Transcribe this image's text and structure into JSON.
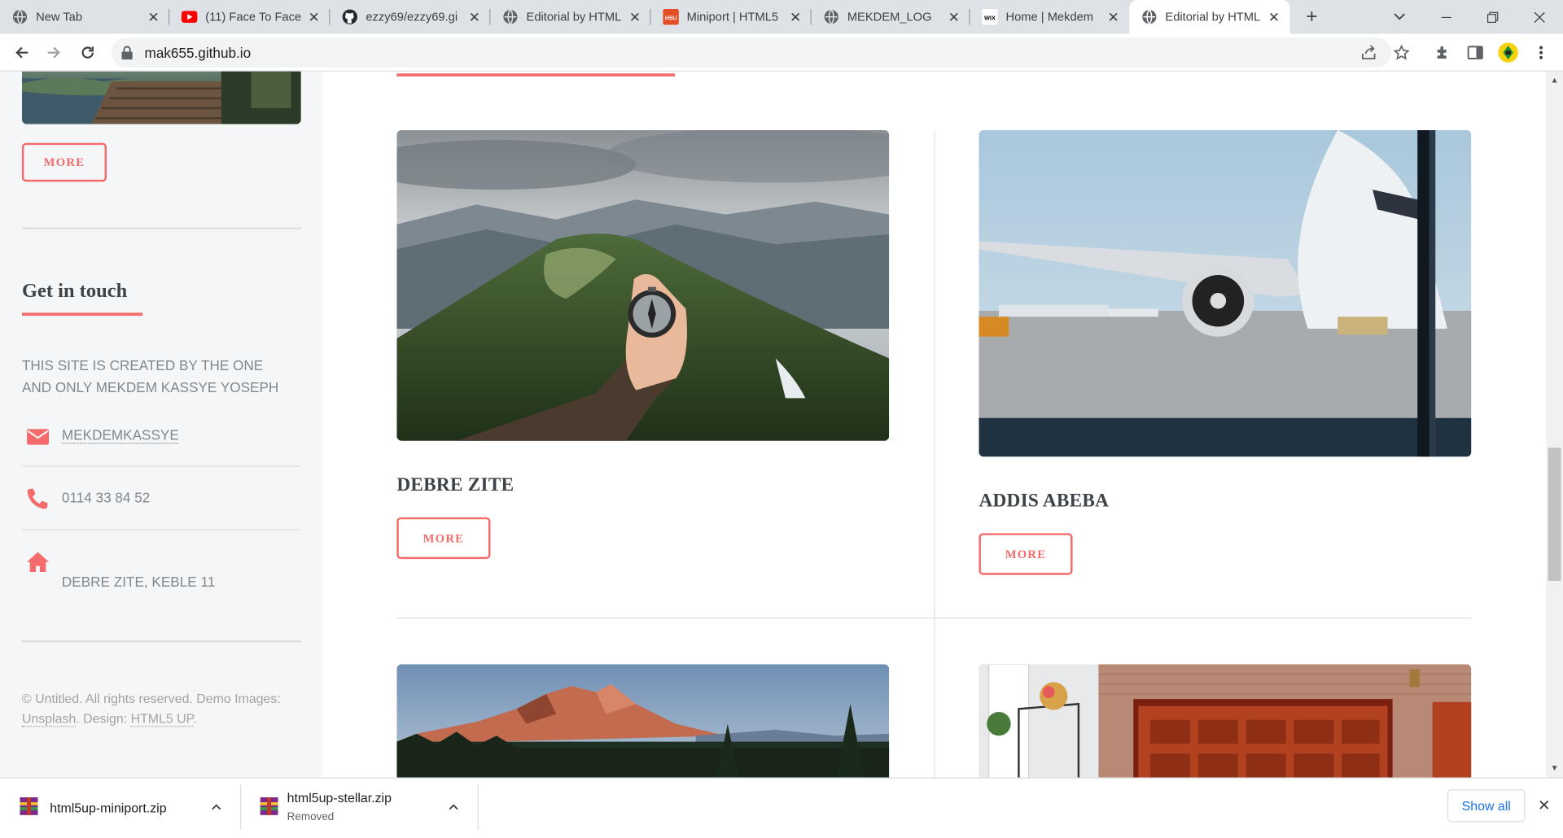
{
  "browser": {
    "tabs": [
      {
        "title": "New Tab",
        "icon": "globe-icon"
      },
      {
        "title": "(11) Face To Face",
        "icon": "youtube-icon"
      },
      {
        "title": "ezzy69/ezzy69.gi",
        "icon": "github-icon"
      },
      {
        "title": "Editorial by HTML",
        "icon": "globe-icon"
      },
      {
        "title": "Miniport | HTML5",
        "icon": "html5up-icon"
      },
      {
        "title": "MEKDEM_LOG",
        "icon": "globe-icon"
      },
      {
        "title": "Home | Mekdem",
        "icon": "wix-icon"
      },
      {
        "title": "Editorial by HTML",
        "icon": "globe-icon",
        "active": true
      }
    ],
    "url": "mak655.github.io"
  },
  "sidebar": {
    "more_label": "MORE",
    "get_in_touch_heading": "Get in touch",
    "about_text": "THIS SITE IS CREATED BY THE ONE AND ONLY MEKDEM KASSYE YOSEPH",
    "contact": {
      "email": "MEKDEMKASSYE",
      "phone": "0114 33 84 52",
      "address": "DEBRE ZITE, KEBLE 11"
    },
    "footer": {
      "prefix": "© Untitled. All rights reserved. Demo Images:",
      "unsplash": "Unsplash",
      "design_label": ". Design:",
      "html5up": "HTML5 UP",
      "suffix": "."
    }
  },
  "main": {
    "cards": [
      {
        "title": "DEBRE ZITE",
        "more_label": "MORE",
        "image": "mountain-compass"
      },
      {
        "title": "ADDIS ABEBA",
        "more_label": "MORE",
        "image": "airplane-airport"
      },
      {
        "title": "",
        "more_label": "",
        "image": "mountain-sunset"
      },
      {
        "title": "",
        "more_label": "",
        "image": "garage-door"
      }
    ]
  },
  "downloads": {
    "items": [
      {
        "name": "html5up-miniport.zip",
        "status": ""
      },
      {
        "name": "html5up-stellar.zip",
        "status": "Removed"
      }
    ],
    "show_all_label": "Show all"
  },
  "colors": {
    "accent": "#f56a6a",
    "heading": "#3d4449",
    "text": "#7f888f",
    "sidebar_bg": "#f5f6f7"
  }
}
